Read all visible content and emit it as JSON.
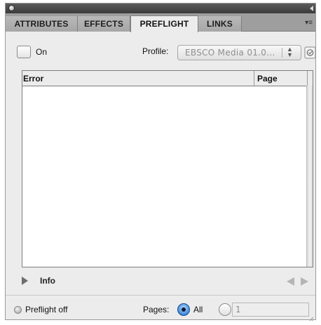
{
  "tabs": [
    {
      "label": "ATTRIBUTES"
    },
    {
      "label": "EFFECTS"
    },
    {
      "label": "PREFLIGHT"
    },
    {
      "label": "LINKS"
    }
  ],
  "active_tab": "PREFLIGHT",
  "preflight": {
    "on_label": "On",
    "on_checked": false,
    "profile_label": "Profile:",
    "profile_value": "EBSCO Media 01.0..."
  },
  "error_table": {
    "columns": [
      "Error",
      "Page"
    ],
    "rows": []
  },
  "info": {
    "label": "Info"
  },
  "status": {
    "text": "Preflight off",
    "pages_label": "Pages:",
    "all_label": "All",
    "selected_option": "All",
    "range_value": "1"
  },
  "icons": {
    "panel_close": "close-icon",
    "collapse": "collapse-icon",
    "tab_menu": "panel-menu-icon",
    "profile_menu": "profile-definitions-icon",
    "info_toggle": "disclosure-triangle-icon",
    "prev": "previous-arrow-icon",
    "next": "next-arrow-icon",
    "status_light": "status-light-icon"
  },
  "colors": {
    "active_tab_bg": "#ececec",
    "tabbar_bg": "#9e9e9e",
    "radio_selected": "#3a86da"
  }
}
